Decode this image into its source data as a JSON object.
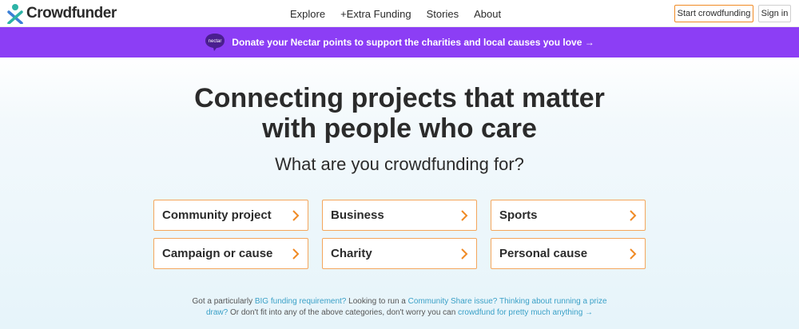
{
  "header": {
    "logo_text": "Crowdfunder",
    "nav": [
      "Explore",
      "+Extra Funding",
      "Stories",
      "About"
    ],
    "start_button": "Start crowdfunding",
    "signin_button": "Sign in"
  },
  "banner": {
    "badge_text": "nectar",
    "text": "Donate your Nectar points to support the charities and local causes you love →"
  },
  "hero": {
    "headline_line1": "Connecting projects that matter",
    "headline_line2": "with people who care",
    "subhead": "What are you crowdfunding for?"
  },
  "categories": [
    "Community project",
    "Business",
    "Sports",
    "Campaign or cause",
    "Charity",
    "Personal cause"
  ],
  "footer": {
    "t1": "Got a particularly ",
    "l1": "BIG funding requirement?",
    "t2": " Looking to run a ",
    "l2": "Community Share issue?",
    "t3": " ",
    "l3": "Thinking about running a prize draw?",
    "t4": " Or don't fit into any of the above categories, don't worry you can ",
    "l4": "crowdfund for pretty much anything →"
  },
  "colors": {
    "accent_orange": "#f08a24",
    "banner_purple": "#8c3ef5",
    "link_blue": "#3aa0c7"
  }
}
